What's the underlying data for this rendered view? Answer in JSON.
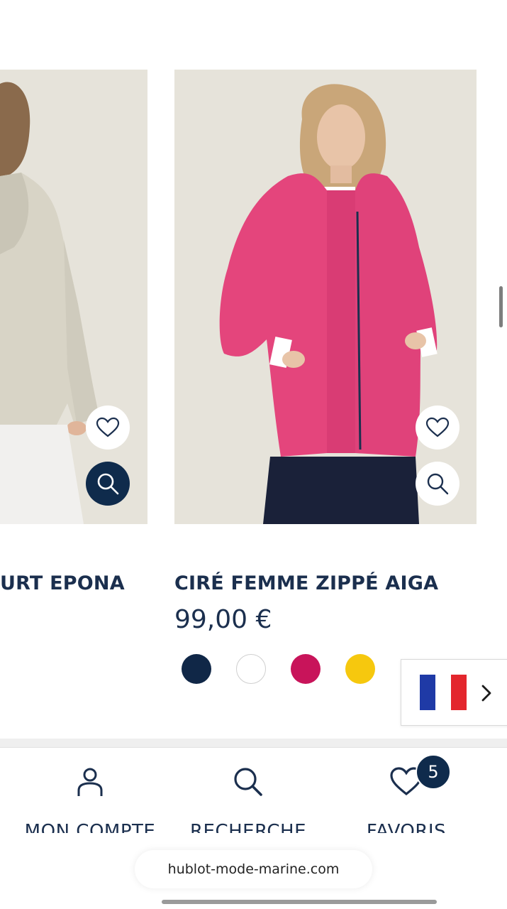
{
  "products": [
    {
      "title": "URT EPONA",
      "image_alt": "model-back-beige-raincoat"
    },
    {
      "title": "CIRÉ FEMME ZIPPÉ AIGA",
      "price": "99,00 €",
      "image_alt": "model-pink-raincoat",
      "swatches": [
        "#102747",
        "#ffffff",
        "#c8145a",
        "#f6c80e"
      ]
    }
  ],
  "language": {
    "flag_colors": [
      "#1f3aa6",
      "#ffffff",
      "#e3262d"
    ]
  },
  "bottom_nav": {
    "account_label": "MON COMPTE",
    "search_label": "RECHERCHE",
    "favorites_label": "FAVORIS",
    "favorites_count": "5"
  },
  "browser": {
    "url": "hublot-mode-marine.com"
  },
  "colors": {
    "navy": "#0f2b4c",
    "image_bg": "#e6e3da"
  }
}
